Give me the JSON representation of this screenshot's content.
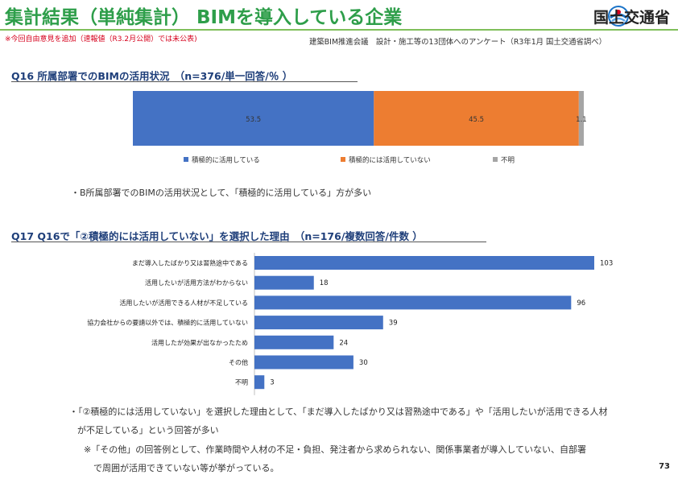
{
  "header": {
    "title": "集計結果（単純集計） BIMを導入している企業",
    "note": "※今回自由意見を追加（速報値（R3.2月公開）では未公表)",
    "source": "建築BIM推進会議　設計・施工等の13団体へのアンケート（R3年1月 国土交通省調べ）",
    "logo_text": "国土交通省"
  },
  "q16": {
    "heading": "Q16  所属部署でのBIMの活用状況　（n=376/単一回答/％ ）",
    "bullet": "・B所属部署でのBIMの活用状況として、「積極的に活用している」方が多い"
  },
  "q17": {
    "heading": "Q17  Q16で「②積極的には活用していない」を選択した理由　（n=176/複数回答/件数 ）",
    "bullet_line1": "・「②積極的には活用していない」を選択した理由として、「まだ導入したばかり又は習熟途中である」や「活用したいが活用できる人材",
    "bullet_line2": "が不足している」という回答が多い",
    "note_line1": "※「その他」の回答例として、作業時間や人材の不足・負担、発注者から求められない、関係事業者が導入していない、自部署",
    "note_line2": "で周囲が活用できていない等が挙がっている。"
  },
  "page_number": "73",
  "chart_data": [
    {
      "type": "bar",
      "orientation": "horizontal-stacked",
      "stacked_100": true,
      "series": [
        {
          "name": "積極的に活用している",
          "values": [
            53.5
          ],
          "color": "#4472c4"
        },
        {
          "name": "積極的には活用していない",
          "values": [
            45.5
          ],
          "color": "#ed7d31"
        },
        {
          "name": "不明",
          "values": [
            1.1
          ],
          "color": "#a5a5a5"
        }
      ],
      "data_labels": [
        "53.5",
        "45.5",
        "1.1"
      ],
      "legend_position": "bottom"
    },
    {
      "type": "bar",
      "orientation": "horizontal",
      "categories": [
        "まだ導入したばかり又は習熟途中である",
        "活用したいが活用方法がわからない",
        "活用したいが活用できる人材が不足している",
        "協力会社からの要請以外では、積極的に活用していない",
        "活用したが効果が出なかったため",
        "その他",
        "不明"
      ],
      "values": [
        103,
        18,
        96,
        39,
        24,
        30,
        3
      ],
      "color": "#4472c4",
      "xlim": [
        0,
        103
      ]
    }
  ]
}
